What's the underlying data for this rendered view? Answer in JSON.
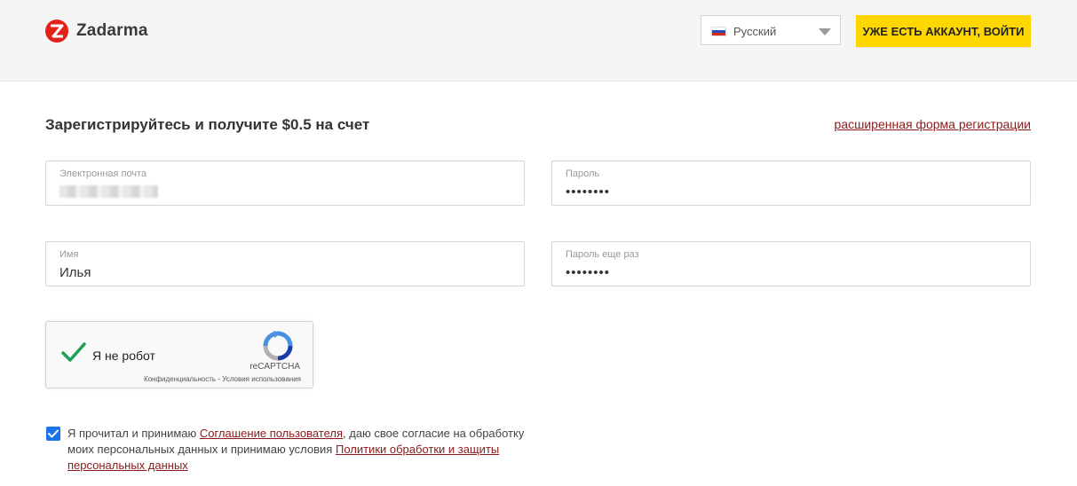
{
  "header": {
    "brand": "Zadarma",
    "language": "Русский",
    "login_button": "УЖЕ ЕСТЬ АККАУНТ, ВОЙТИ",
    "colors": {
      "accent": "#ffd700",
      "logo_red": "#e32119"
    }
  },
  "form": {
    "title": "Зарегистрируйтесь и получите $0.5 на счет",
    "advanced_link": "расширенная форма регистрации",
    "email": {
      "label": "Электронная почта",
      "value": ""
    },
    "password": {
      "label": "Пароль",
      "value": "••••••••"
    },
    "name": {
      "label": "Имя",
      "value": "Илья"
    },
    "password_repeat": {
      "label": "Пароль еще раз",
      "value": "••••••••"
    }
  },
  "captcha": {
    "label": "Я не робот",
    "brand": "reCAPTCHA",
    "privacy": "Конфиденциальность",
    "separator": " - ",
    "terms": "Условия использования",
    "checked": true
  },
  "agreement": {
    "checked": true,
    "text_1": "Я прочитал и принимаю ",
    "link_1": "Соглашение пользователя",
    "text_2": ", даю свое согласие на обработку моих персональных данных и принимаю условия ",
    "link_2": "Политики обработки и защиты персональных данных"
  }
}
